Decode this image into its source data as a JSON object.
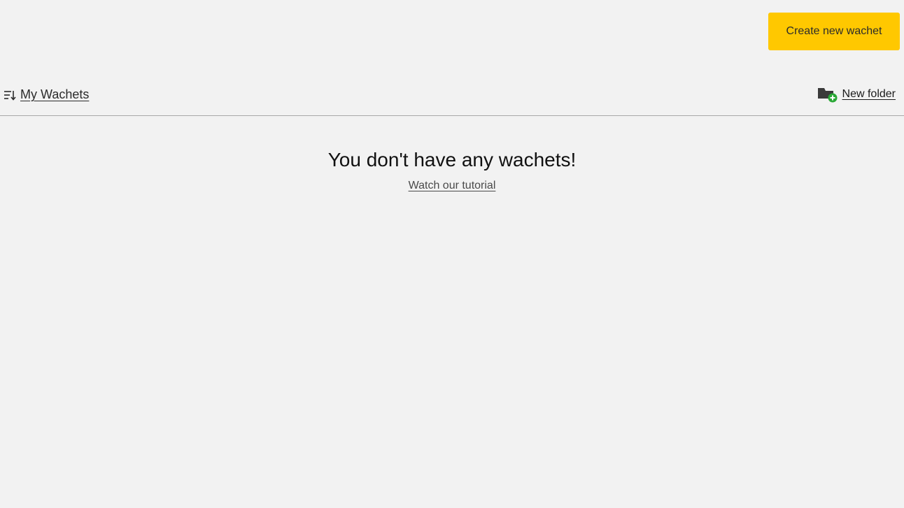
{
  "header": {
    "create_button_label": "Create new wachet",
    "accent_color": "#ffc800"
  },
  "folder_bar": {
    "title": "My Wachets",
    "sort_icon": "sort-descending-icon",
    "new_folder_label": "New folder",
    "new_folder_icon": "folder-add-icon",
    "add_badge_color": "#2aa836"
  },
  "empty_state": {
    "message": "You don't have any wachets!",
    "tutorial_link": "Watch our tutorial"
  }
}
